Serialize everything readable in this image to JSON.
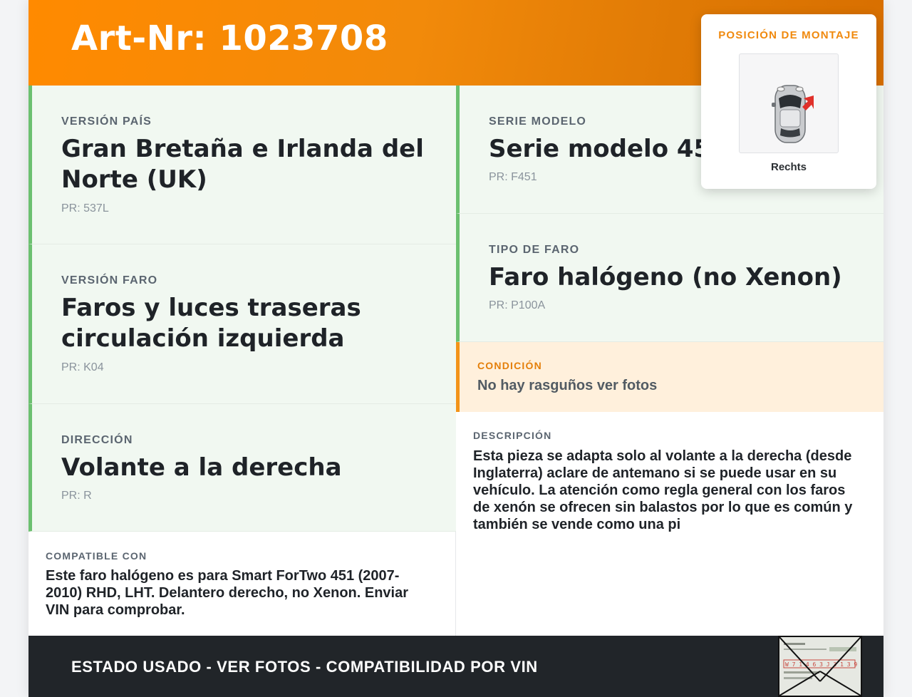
{
  "header": {
    "title": "Art-Nr: 1023708"
  },
  "left_cells": [
    {
      "label": "VERSIÓN PAÍS",
      "value": "Gran Bretaña e Irlanda del Norte (UK)",
      "pr": "PR: 537L"
    },
    {
      "label": "VERSIÓN FARO",
      "value": "Faros y luces traseras circulación izquierda",
      "pr": "PR: K04"
    },
    {
      "label": "DIRECCIÓN",
      "value": "Volante a la derecha",
      "pr": "PR: R"
    }
  ],
  "right_cells": [
    {
      "label": "SERIE MODELO",
      "value": "Serie modelo 451",
      "pr": "PR: F451"
    },
    {
      "label": "TIPO DE FARO",
      "value": "Faro halógeno (no Xenon)",
      "pr": "PR: P100A"
    }
  ],
  "condition": {
    "label": "CONDICIÓN",
    "value": "No hay rasguños ver fotos"
  },
  "compatible": {
    "label": "COMPATIBLE CON",
    "text": "Este faro halógeno es para Smart ForTwo 451 (2007-2010) RHD, LHT. Delantero derecho, no Xenon. Enviar VIN para comprobar."
  },
  "description": {
    "label": "DESCRIPCIÓN",
    "text": "Esta pieza se adapta solo al volante a la derecha (desde Inglaterra) aclare de antemano si se puede usar en su vehículo. La atención como regla general con los faros de xenón se ofrecen sin balastos por lo que es común y también se vende como una pi"
  },
  "mount_position": {
    "label": "POSICIÓN DE MONTAJE",
    "value": "Rechts",
    "icon": "car-top-view-icon"
  },
  "footer": {
    "text": "ESTADO USADO - VER FOTOS - COMPATIBILIDAD POR VIN",
    "document_text": "W 7 1 4 6 3 J 3 1 3 9 7"
  },
  "colors": {
    "header_orange": "#ff8a00",
    "accent_green": "#6cc070",
    "accent_orange": "#f39419",
    "footer_dark": "#212529"
  }
}
